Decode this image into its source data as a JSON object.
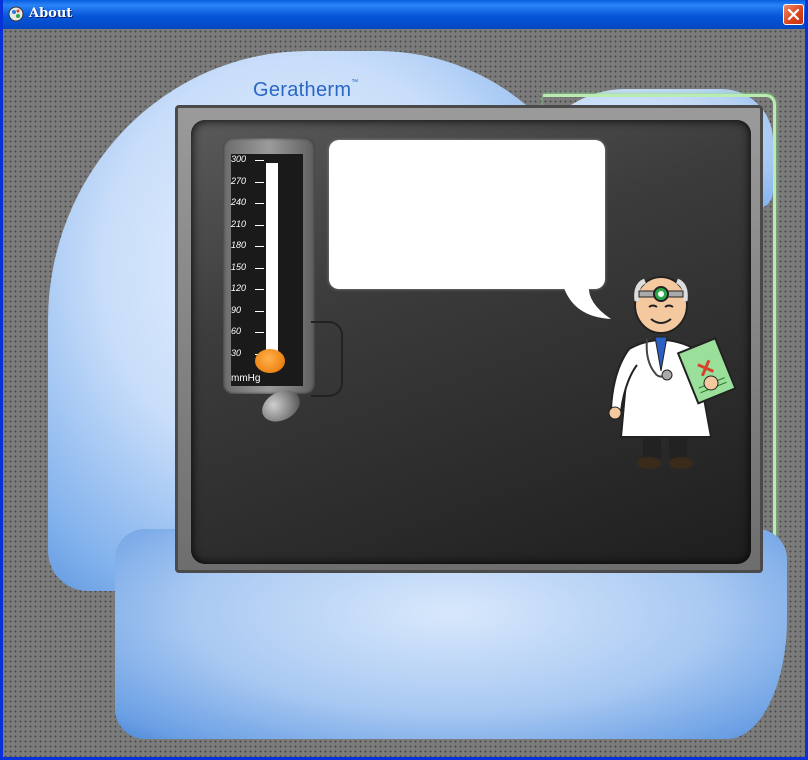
{
  "window": {
    "title": "About",
    "close_icon": "close-icon"
  },
  "logo": {
    "text": "Geratherm",
    "mark": "™"
  },
  "gauge": {
    "unit": "mmHg",
    "ticks": [
      "300",
      "270",
      "240",
      "210",
      "180",
      "150",
      "120",
      "90",
      "60",
      "30"
    ],
    "reading_mmhg": 30
  },
  "speech_bubble": {
    "text": ""
  },
  "icons": {
    "app": "app-icon",
    "doctor": "doctor-illustration",
    "pump": "bulb-pump-icon"
  },
  "colors": {
    "titlebar": "#0a5fe0",
    "close": "#d8411a",
    "blue_shape": "#7fb0ec",
    "logo": "#2a67c4",
    "mercury": "#f08a1c"
  }
}
